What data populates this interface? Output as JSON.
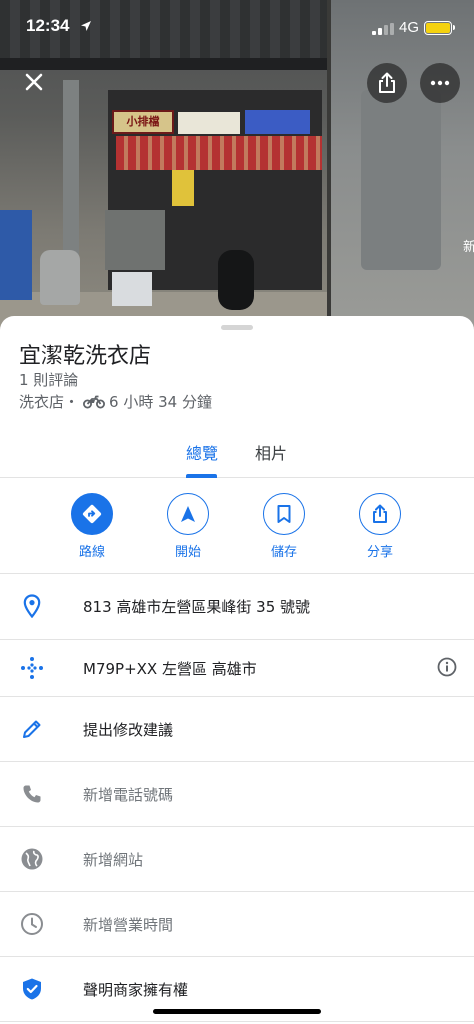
{
  "status_bar": {
    "time": "12:34",
    "network": "4G"
  },
  "photo": {
    "edge_text": "新",
    "sign_text": "小排檔"
  },
  "place": {
    "title": "宜潔乾洗衣店",
    "reviews": "1 則評論",
    "category": "洗衣店・",
    "travel_time": "6 小時 34 分鐘"
  },
  "tabs": [
    {
      "label": "總覽",
      "active": true
    },
    {
      "label": "相片",
      "active": false
    }
  ],
  "actions": [
    {
      "label": "路線",
      "icon": "directions-icon"
    },
    {
      "label": "開始",
      "icon": "navigation-icon"
    },
    {
      "label": "儲存",
      "icon": "bookmark-icon"
    },
    {
      "label": "分享",
      "icon": "share-icon"
    }
  ],
  "details": [
    {
      "icon": "location-pin-icon",
      "text": "813 高雄市左營區果峰街 35 號號",
      "muted": false
    },
    {
      "icon": "plus-code-icon",
      "text": "M79P+XX 左營區 高雄市",
      "muted": false
    },
    {
      "icon": "edit-pencil-icon",
      "text": "提出修改建議",
      "muted": false
    },
    {
      "icon": "phone-icon",
      "text": "新增電話號碼",
      "muted": true
    },
    {
      "icon": "globe-icon",
      "text": "新增網站",
      "muted": true
    },
    {
      "icon": "clock-icon",
      "text": "新增營業時間",
      "muted": true
    },
    {
      "icon": "verified-shield-icon",
      "text": "聲明商家擁有權",
      "muted": false
    }
  ],
  "colors": {
    "accent": "#1a73e8",
    "battery": "#f5d20f"
  }
}
